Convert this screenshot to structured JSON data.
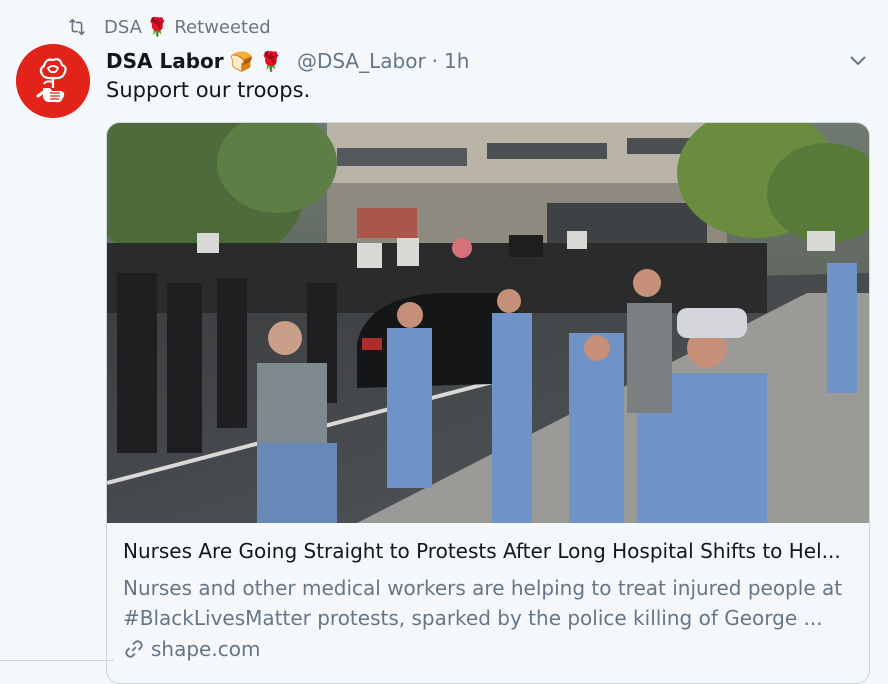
{
  "retweet": {
    "icon": "retweet-icon",
    "account": "DSA",
    "emoji": "🌹",
    "label": "Retweeted"
  },
  "tweet": {
    "display_name": "DSA Labor",
    "name_emojis": "🍞 🌹",
    "handle": "@DSA_Labor",
    "separator": "·",
    "time": "1h",
    "text": "Support our troops.",
    "avatar_icon": "dsa-rose-fist-logo"
  },
  "card": {
    "title": "Nurses Are Going Straight to Protests After Long Hospital Shifts to Hel...",
    "description_line1": "Nurses and other medical workers are helping to treat injured people at",
    "description_line2": "#BlackLivesMatter protests, sparked by the police killing of George ...",
    "domain": "shape.com",
    "image_alt": "Nurses in scrubs applauding protesters on a city street"
  },
  "colors": {
    "background": "#f5f8fa",
    "text_primary": "#14171a",
    "text_secondary": "#657786",
    "border": "#ccd6dd",
    "dsa_red": "#e2231a"
  }
}
